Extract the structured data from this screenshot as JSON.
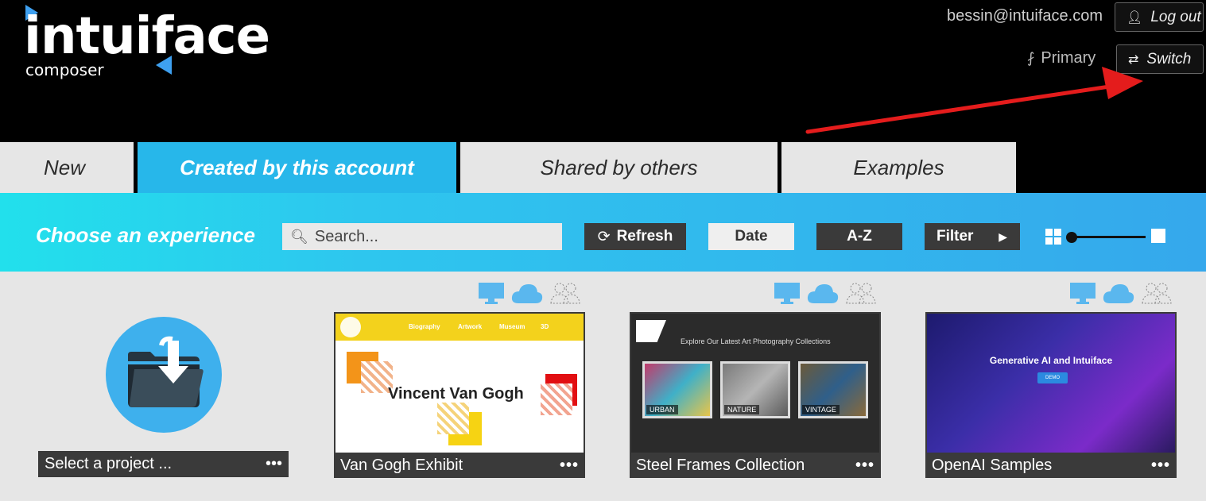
{
  "app": {
    "logo_word": "intuiface",
    "logo_sub": "composer"
  },
  "account": {
    "email": "bessin@intuiface.com",
    "logout_label": "Log out",
    "workspace_label": "Primary",
    "switch_label": "Switch"
  },
  "tabs": [
    {
      "label": "New"
    },
    {
      "label": "Created by this account",
      "active": true
    },
    {
      "label": "Shared by others"
    },
    {
      "label": "Examples"
    }
  ],
  "toolbar": {
    "heading": "Choose an experience",
    "search_placeholder": "Search...",
    "refresh_label": "Refresh",
    "date_label": "Date",
    "az_label": "A-Z",
    "filter_label": "Filter"
  },
  "select_project": {
    "label": "Select a project ..."
  },
  "cards": [
    {
      "title": "Van Gogh Exhibit",
      "thumb": {
        "nav": [
          "Biography",
          "Artwork",
          "Museum",
          "3D"
        ],
        "heading": "Vincent Van Gogh"
      }
    },
    {
      "title": "Steel Frames Collection",
      "thumb": {
        "heading": "Explore Our Latest Art Photography Collections",
        "tiles": [
          "URBAN",
          "NATURE",
          "VINTAGE"
        ]
      }
    },
    {
      "title": "OpenAI Samples",
      "thumb": {
        "heading": "Generative AI and Intuiface",
        "badge": "DEMO"
      }
    }
  ],
  "more_label": "•••",
  "colors": {
    "accent": "#27b7ea",
    "dark": "#3a3a3a",
    "annotation": "#e41c1c"
  }
}
